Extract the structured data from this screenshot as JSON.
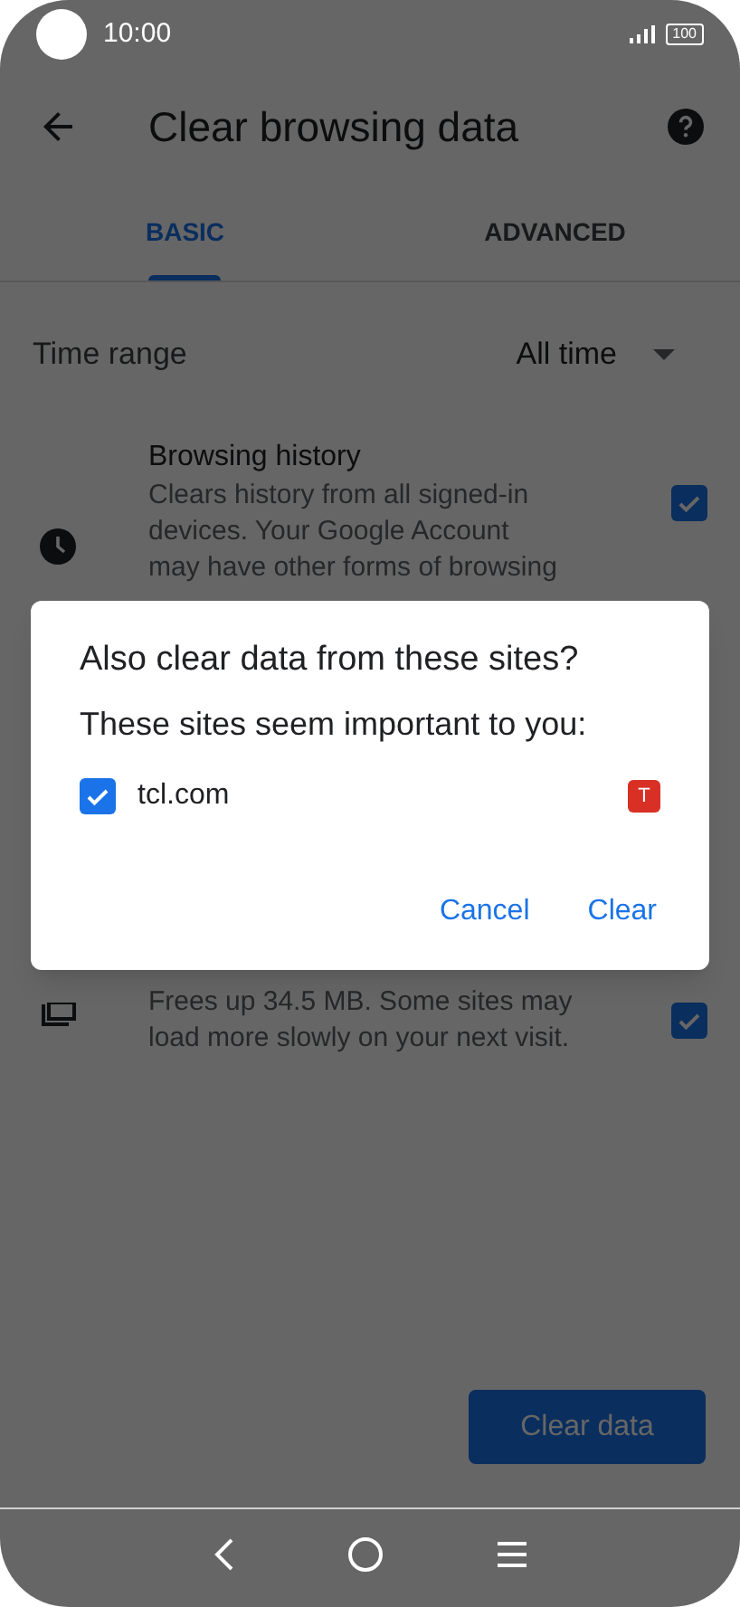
{
  "status_bar": {
    "time": "10:00",
    "battery": "100"
  },
  "toolbar": {
    "title": "Clear browsing data"
  },
  "tabs": [
    {
      "label": "BASIC",
      "selected": true
    },
    {
      "label": "ADVANCED",
      "selected": false
    }
  ],
  "time_range": {
    "label": "Time range",
    "value": "All time"
  },
  "items": [
    {
      "kind": "history",
      "title": "Browsing history",
      "lines": [
        "Clears history from all signed-in",
        "devices. Your Google Account",
        "may have other forms of browsing"
      ],
      "checked": true
    },
    {
      "kind": "cache",
      "lines": [
        "Frees up 34.5 MB. Some sites may",
        "load more slowly on your next visit."
      ],
      "checked": true
    }
  ],
  "dialog": {
    "title": "Also clear data from these sites?",
    "subtitle": "These sites seem important to you:",
    "sites": [
      {
        "label": "tcl.com",
        "checked": true,
        "favicon": "T",
        "color": "#d93025"
      }
    ],
    "buttons": [
      "Cancel",
      "Clear"
    ]
  },
  "clear_button": "Clear data"
}
